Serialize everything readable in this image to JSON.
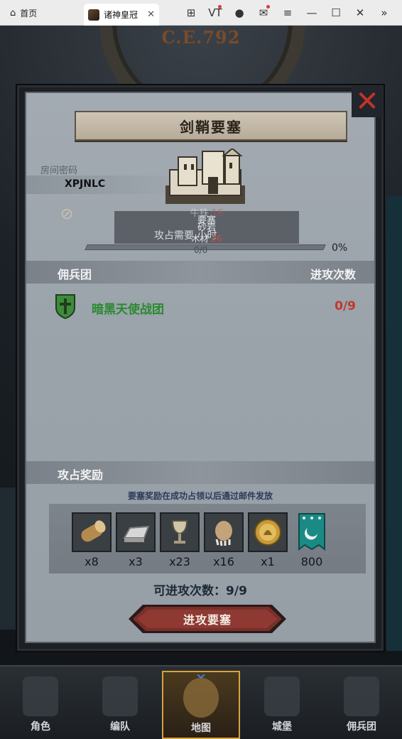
{
  "browser": {
    "home_label": "首页",
    "tab_label": "诸神皇冠",
    "vt_label": "VT"
  },
  "scene": {
    "era": "C.E.792"
  },
  "panel": {
    "title": "剑鞘要塞",
    "room_label": "房间密码",
    "room_code": "XPJNLC",
    "status": {
      "line1": "牛铁",
      "line1_value": "16",
      "line2": "砂岩",
      "line2_value": "26",
      "line3": "木材",
      "fort_label": "要塞",
      "ghost": "攻占需要 小时"
    },
    "progress": {
      "count": "0/0",
      "percent_text": "0%",
      "fraction": 0
    },
    "mercenary_header": "佣兵团",
    "attack_count_header": "进攻次数",
    "guild": {
      "name": "暗黑天使战团",
      "count": "0/9"
    },
    "reward_header": "攻占奖励",
    "reward_note": "要塞奖励在成功占领以后通过邮件发放",
    "rewards": [
      {
        "icon": "wood-log-icon",
        "qty": "x8"
      },
      {
        "icon": "iron-ingot-icon",
        "qty": "x3"
      },
      {
        "icon": "goblet-icon",
        "qty": "x23"
      },
      {
        "icon": "fur-pelt-icon",
        "qty": "x16"
      },
      {
        "icon": "gold-medal-icon",
        "qty": "x1"
      },
      {
        "icon": "guild-banner-icon",
        "qty": "800"
      }
    ],
    "attempts": "可进攻次数：9/9",
    "attack_button": "进攻要塞"
  },
  "nav": [
    {
      "label": "角色",
      "icon": "knight-icon"
    },
    {
      "label": "编队",
      "icon": "helmet-icon"
    },
    {
      "label": "地图",
      "icon": "map-icon",
      "active": true
    },
    {
      "label": "城堡",
      "icon": "castle-icon"
    },
    {
      "label": "佣兵团",
      "icon": "mercenary-icon"
    }
  ],
  "colors": {
    "close": "#c3322a",
    "guild_name": "#2a8a2e",
    "guild_count": "#c0392b",
    "button": "#7a2e2a",
    "nav_active": "#d9a23c"
  }
}
